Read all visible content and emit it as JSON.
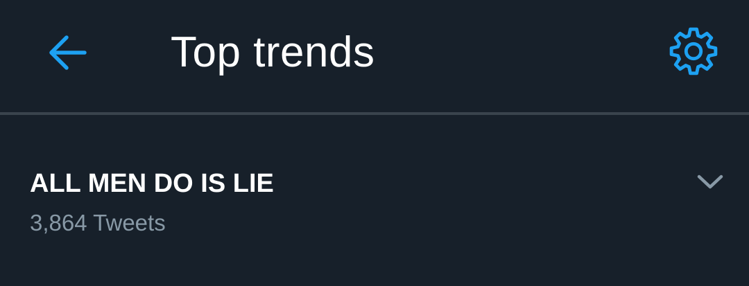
{
  "header": {
    "title": "Top trends",
    "back_icon": "arrow-left-icon",
    "settings_icon": "gear-icon"
  },
  "trends": [
    {
      "name": "ALL MEN DO IS LIE",
      "count": "3,864 Tweets",
      "menu_icon": "chevron-down-icon"
    }
  ],
  "colors": {
    "background": "#17202a",
    "accent": "#1da1f2",
    "divider": "#3a444d",
    "secondary_text": "#8899a6",
    "primary_text": "#ffffff"
  }
}
